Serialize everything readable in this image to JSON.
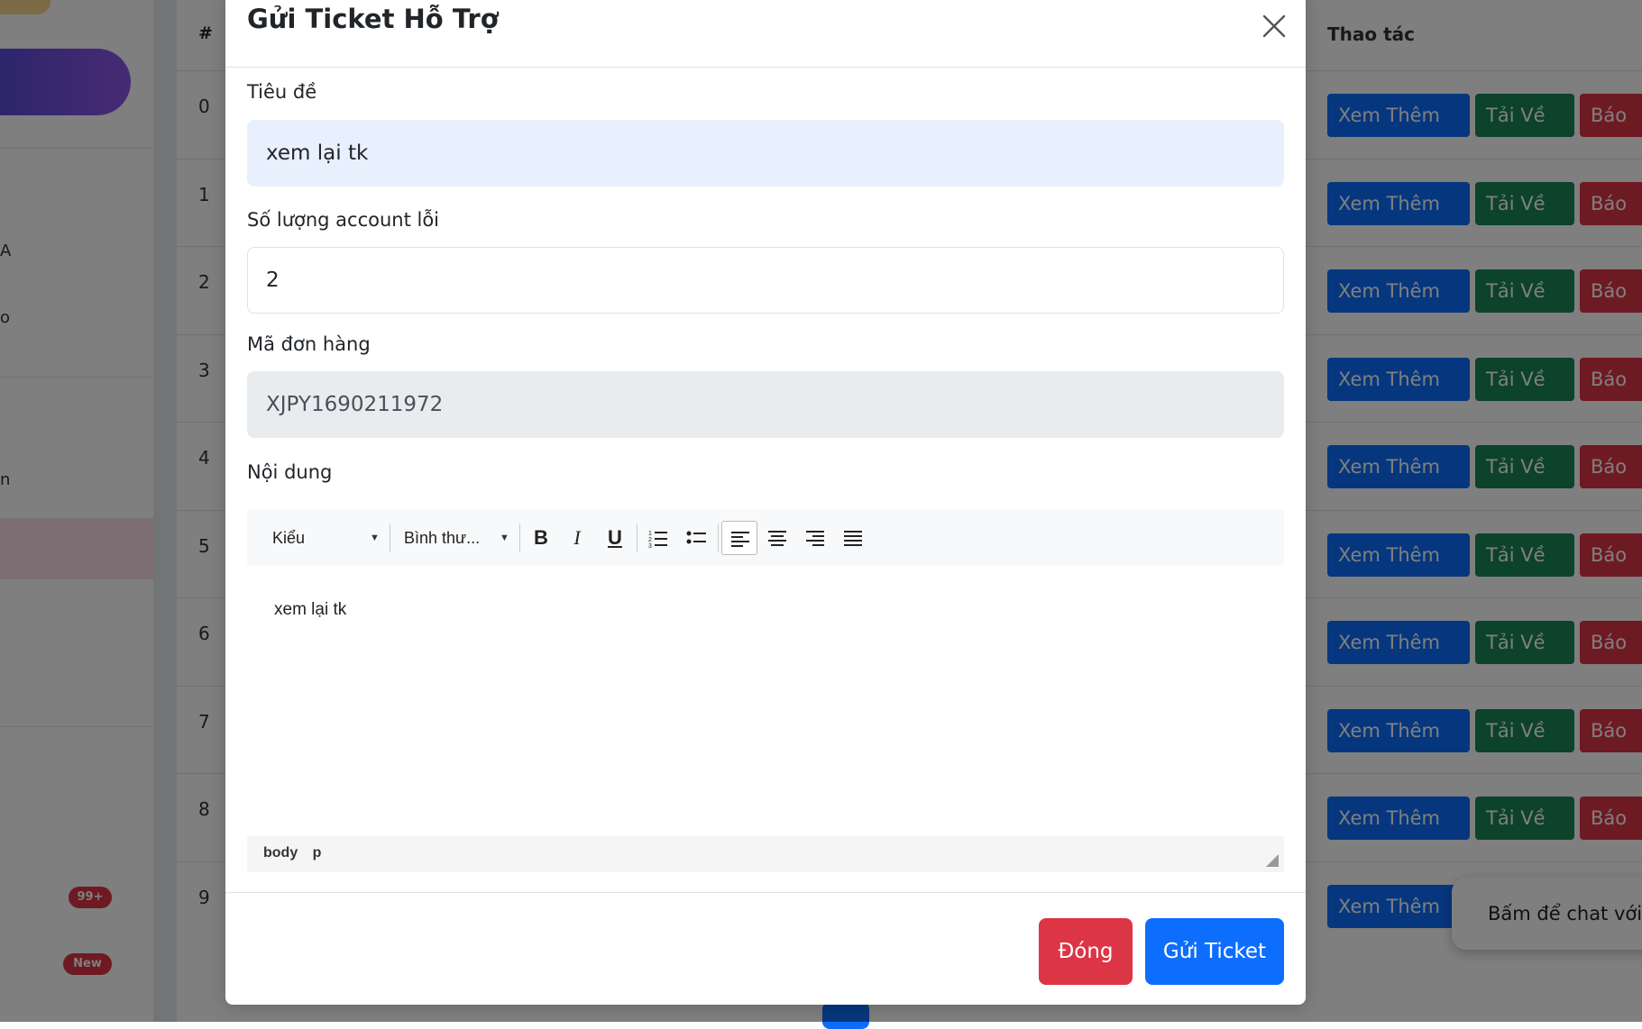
{
  "background": {
    "sidebar": {
      "top_tag": "%",
      "edge_letters": [
        "A",
        "o",
        "n"
      ],
      "badges": [
        "99+",
        "New"
      ]
    },
    "table": {
      "col_index": "#",
      "col_actions": "Thao tác",
      "rows": [
        "0",
        "1",
        "2",
        "3",
        "4",
        "5",
        "6",
        "7",
        "8",
        "9"
      ],
      "view_more_label": "Xem Thêm",
      "download_label": "Tải Về",
      "report_label": "Báo"
    },
    "chat_prompt": "Bấm để chat với Admin"
  },
  "modal": {
    "title": "Gửi Ticket Hỗ Trợ",
    "fields": {
      "title_label": "Tiêu đề",
      "title_value": "xem lại tk",
      "count_label": "Số lượng account lỗi",
      "count_value": "2",
      "order_label": "Mã đơn hàng",
      "order_value": "XJPY1690211972",
      "content_label": "Nội dung"
    },
    "editor": {
      "style_select": "Kiểu",
      "format_select": "Bình thư...",
      "content": "xem lại tk",
      "status_path": "body p"
    },
    "buttons": {
      "close": "Đóng",
      "submit": "Gửi Ticket"
    }
  },
  "colors": {
    "primary": "#0d6efd",
    "success": "#198754",
    "danger": "#dc3545",
    "accent_gradient_start": "#5b4bd8",
    "accent_gradient_end": "#8e56e8"
  }
}
